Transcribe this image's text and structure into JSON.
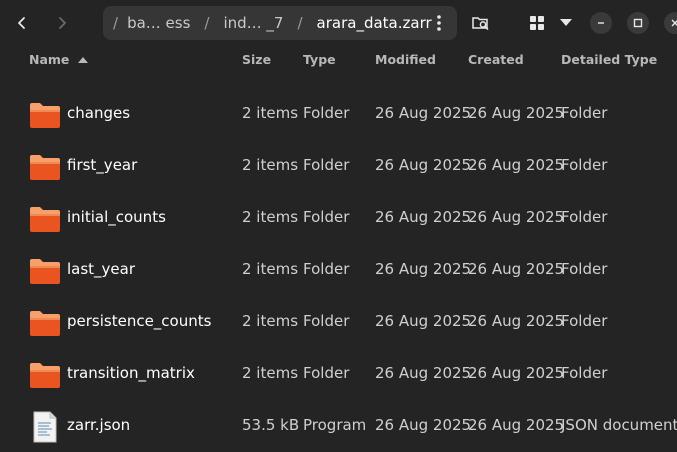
{
  "pathbar": {
    "segments": [
      "ba… ess",
      "ind… _7",
      "arara_data.zarr"
    ]
  },
  "columns": {
    "name": "Name",
    "size": "Size",
    "type": "Type",
    "modified": "Modified",
    "created": "Created",
    "detailed_type": "Detailed Type"
  },
  "files": [
    {
      "name": "changes",
      "size": "2 items",
      "type": "Folder",
      "modified": "26 Aug 2025",
      "created": "26 Aug 2025",
      "detailed_type": "Folder",
      "icon": "folder-icon"
    },
    {
      "name": "first_year",
      "size": "2 items",
      "type": "Folder",
      "modified": "26 Aug 2025",
      "created": "26 Aug 2025",
      "detailed_type": "Folder",
      "icon": "folder-icon"
    },
    {
      "name": "initial_counts",
      "size": "2 items",
      "type": "Folder",
      "modified": "26 Aug 2025",
      "created": "26 Aug 2025",
      "detailed_type": "Folder",
      "icon": "folder-icon"
    },
    {
      "name": "last_year",
      "size": "2 items",
      "type": "Folder",
      "modified": "26 Aug 2025",
      "created": "26 Aug 2025",
      "detailed_type": "Folder",
      "icon": "folder-icon"
    },
    {
      "name": "persistence_counts",
      "size": "2 items",
      "type": "Folder",
      "modified": "26 Aug 2025",
      "created": "26 Aug 2025",
      "detailed_type": "Folder",
      "icon": "folder-icon"
    },
    {
      "name": "transition_matrix",
      "size": "2 items",
      "type": "Folder",
      "modified": "26 Aug 2025",
      "created": "26 Aug 2025",
      "detailed_type": "Folder",
      "icon": "folder-icon"
    },
    {
      "name": "zarr.json",
      "size": "53.5 kB",
      "type": "Program",
      "modified": "26 Aug 2025",
      "created": "26 Aug 2025",
      "detailed_type": "JSON document",
      "icon": "json-file-icon"
    }
  ],
  "colors": {
    "background": "#242424",
    "folder": "#e95420",
    "folder_light": "#f7a06a"
  }
}
